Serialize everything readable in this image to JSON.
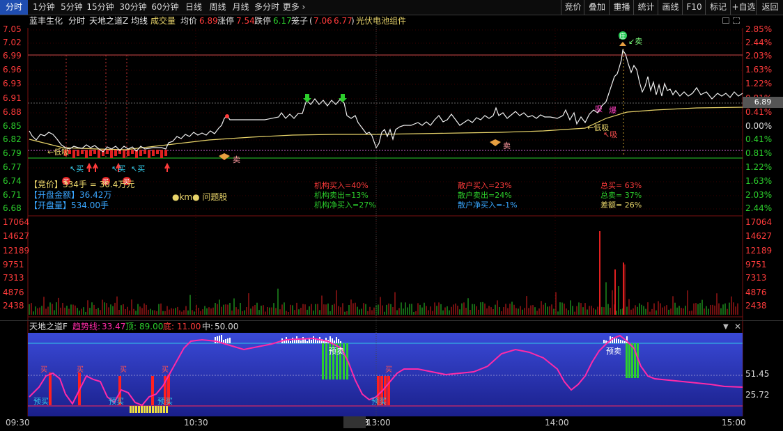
{
  "toolbar": {
    "left_tabs": [
      {
        "label": "分时",
        "active": true
      },
      {
        "label": "1分钟"
      },
      {
        "label": "5分钟"
      },
      {
        "label": "15分钟"
      },
      {
        "label": "30分钟"
      },
      {
        "label": "60分钟"
      },
      {
        "label": "日线"
      },
      {
        "label": "周线"
      },
      {
        "label": "月线"
      },
      {
        "label": "多分时"
      },
      {
        "label": "更多 ›"
      }
    ],
    "right_buttons": [
      "竞价",
      "叠加",
      "重播",
      "统计",
      "画线",
      "F10",
      "标记",
      "+自选",
      "返回"
    ]
  },
  "info": {
    "stock_name": "蓝丰生化",
    "mode": "分时",
    "indicator_name": "天地之道Z",
    "avg_line": "均线",
    "volume": "成交量",
    "avg_price_label": "均价",
    "avg_price": "6.89",
    "limit_up_label": "涨停",
    "limit_up": "7.54",
    "limit_down_label": "跌停",
    "limit_down": "6.17",
    "cage_label": "笼子",
    "cage_open": "(",
    "cage_high": "7.06",
    "cage_low": "6.77",
    "cage_close": ")",
    "concept": "光伏电池组件"
  },
  "price_axis": {
    "left": [
      "7.05",
      "7.02",
      "6.99",
      "6.96",
      "6.93",
      "6.91",
      "6.88",
      "6.85",
      "6.82",
      "6.79",
      "6.77",
      "6.74",
      "6.71",
      "6.68"
    ],
    "right": [
      "2.85%",
      "2.44%",
      "2.03%",
      "1.63%",
      "1.22%",
      "0.81%",
      "0.41%",
      "0.00%",
      "0.41%",
      "0.81%",
      "1.22%",
      "1.63%",
      "2.03%",
      "2.44%"
    ],
    "current_price": "6.89"
  },
  "volume_axis": [
    "17064",
    "14627",
    "12189",
    "9751",
    "7313",
    "4876",
    "2438"
  ],
  "auction_box": {
    "auction_label": "【竞价】",
    "auction_value": "334手 = 30.4万元",
    "open_amount_label": "【开盘金额】",
    "open_amount": "36.42万",
    "open_volume_label": "【开盘量】",
    "open_volume": "534.00手",
    "tag": "●km● 问题股"
  },
  "flow_stats": {
    "inst_buy": "机构买入=40%",
    "inst_sell": "机构卖出=13%",
    "inst_net": "机构净买入=27%",
    "retail_buy": "散户买入=23%",
    "retail_sell": "散户卖出=24%",
    "retail_net": "散户净买入=-1%",
    "total_buy": "总买= 63%",
    "total_sell": "总卖= 37%",
    "diff": "差额= 26%"
  },
  "chart_labels": {
    "low_buy": "←低吸",
    "buy": "买",
    "sell": "卖",
    "suck": "吸",
    "burst": "爆",
    "sell_arrow": "↙卖",
    "low_suck": "←低吸",
    "suck_arrow": "↖吸",
    "special": "庄",
    "buy_tag": "买"
  },
  "sub_panel": {
    "name": "天地之道F",
    "trend_label": "趋势线:",
    "trend_value": "33.47",
    "top_label": "顶:",
    "top_value": "89.00",
    "bottom_label": "底:",
    "bottom_value": "11.00",
    "mid_label": "中:",
    "mid_value": "50.00",
    "axis": [
      "51.45",
      "25.72"
    ],
    "pre_buy": "预买",
    "pre_sell": "预卖",
    "buy": "买"
  },
  "time_axis": {
    "labels": [
      "09:30",
      "10:30",
      "11:23",
      "13:00",
      "14:00",
      "15:00"
    ]
  },
  "colors": {
    "up": "#ff3b3b",
    "down": "#2ccf2c",
    "avg": "#e8d46a",
    "blue_panel": "#2c35c8",
    "magenta": "#ff2aa8",
    "cyan": "#32c8e6"
  }
}
